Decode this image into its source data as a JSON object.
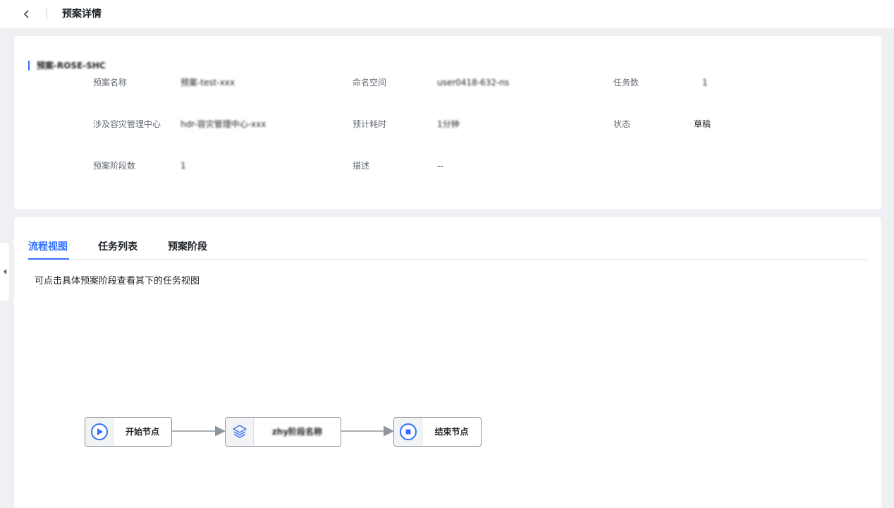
{
  "header": {
    "title": "预案详情"
  },
  "info": {
    "section_title": "预案-ROSE-SHC",
    "fields": {
      "plan_name": {
        "label": "预案名称",
        "value": "预案-test-xxx"
      },
      "namespace": {
        "label": "命名空间",
        "value": "user0418-632-ns"
      },
      "task_count": {
        "label": "任务数",
        "value": "1"
      },
      "dr_center": {
        "label": "涉及容灾管理中心",
        "value": "hdr-容灾管理中心-xxx"
      },
      "est_time": {
        "label": "预计耗时",
        "value": "1分钟"
      },
      "status": {
        "label": "状态",
        "value": "草稿"
      },
      "stage_count": {
        "label": "预案阶段数",
        "value": "1"
      },
      "description": {
        "label": "描述",
        "value": "--"
      }
    }
  },
  "tabs": [
    {
      "label": "流程视图",
      "active": true
    },
    {
      "label": "任务列表",
      "active": false
    },
    {
      "label": "预案阶段",
      "active": false
    }
  ],
  "flow": {
    "hint": "可点击具体预案阶段查看其下的任务视图",
    "nodes": [
      {
        "label": "开始节点",
        "icon": "play-icon"
      },
      {
        "label": "zhy阶段名称",
        "icon": "layers-icon"
      },
      {
        "label": "结束节点",
        "icon": "stop-icon"
      }
    ]
  },
  "colors": {
    "accent": "#3370ff",
    "node_border": "#8f959e",
    "edge": "#8f959e"
  }
}
